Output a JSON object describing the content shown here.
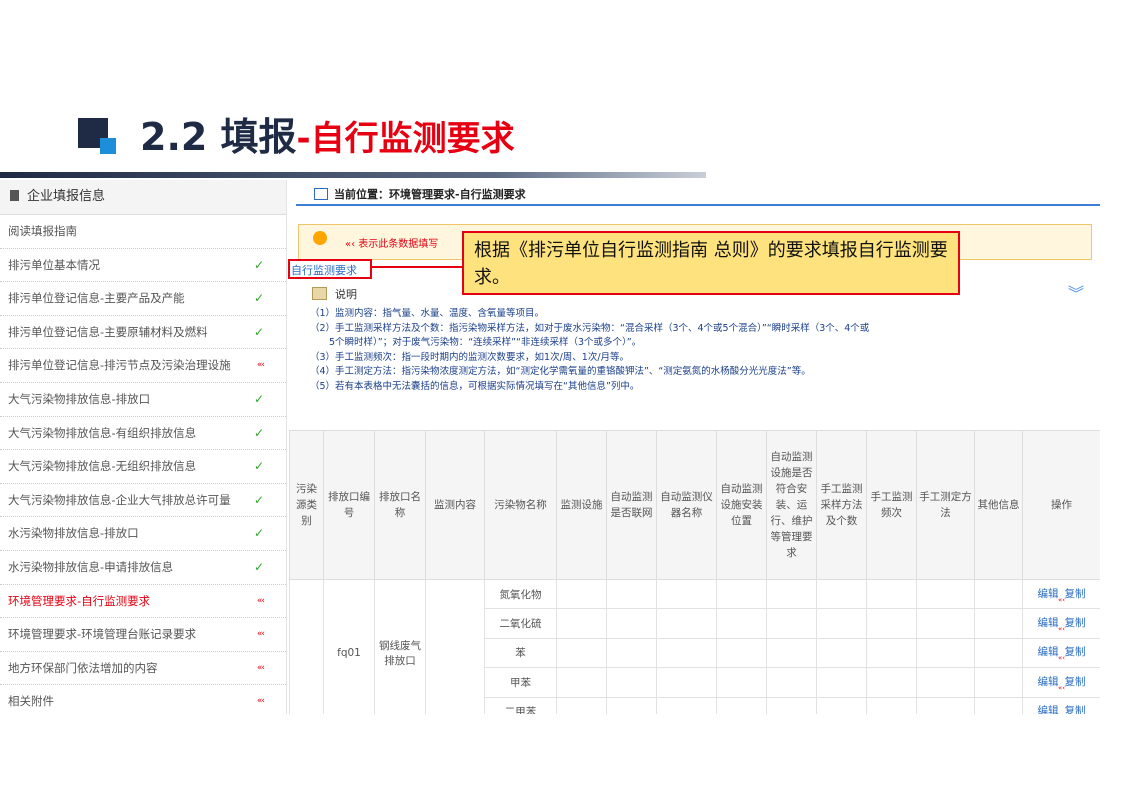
{
  "slide": {
    "title_prefix": "2.2  填报",
    "title_suffix": "-自行监测要求"
  },
  "sidebar": {
    "header": "企业填报信息",
    "items": [
      {
        "label": "阅读填报指南",
        "status": "",
        "active": false
      },
      {
        "label": "排污单位基本情况",
        "status": "✓",
        "active": false
      },
      {
        "label": "排污单位登记信息-主要产品及产能",
        "status": "✓",
        "active": false
      },
      {
        "label": "排污单位登记信息-主要原辅材料及燃料",
        "status": "✓",
        "active": false
      },
      {
        "label": "排污单位登记信息-排污节点及污染治理设施",
        "status": "«‹",
        "active": false
      },
      {
        "label": "大气污染物排放信息-排放口",
        "status": "✓",
        "active": false
      },
      {
        "label": "大气污染物排放信息-有组织排放信息",
        "status": "✓",
        "active": false
      },
      {
        "label": "大气污染物排放信息-无组织排放信息",
        "status": "✓",
        "active": false
      },
      {
        "label": "大气污染物排放信息-企业大气排放总许可量",
        "status": "✓",
        "active": false
      },
      {
        "label": "水污染物排放信息-排放口",
        "status": "✓",
        "active": false
      },
      {
        "label": "水污染物排放信息-申请排放信息",
        "status": "✓",
        "active": false
      },
      {
        "label": "环境管理要求-自行监测要求",
        "status": "«‹",
        "active": true
      },
      {
        "label": "环境管理要求-环境管理台账记录要求",
        "status": "«‹",
        "active": false
      },
      {
        "label": "地方环保部门依法增加的内容",
        "status": "«‹",
        "active": false
      },
      {
        "label": "相关附件",
        "status": "«‹",
        "active": false
      }
    ]
  },
  "main": {
    "breadcrumb": "当前位置：环境管理要求-自行监测要求",
    "notice": "«‹ 表示此条数据填写",
    "callout": "根据《排污单位自行监测指南  总则》的要求填报自行监测要求。",
    "section_link": "自行监测要求",
    "explain_label": "说明",
    "notes": [
      "（1）监测内容：指气量、水量、温度、含氧量等项目。",
      "（2）手工监测采样方法及个数：指污染物采样方法，如对于废水污染物：“混合采样（3个、4个或5个混合）”“瞬时采样（3个、4个或",
      "5个瞬时样）”；对于废气污染物：“连续采样”“非连续采样（3个或多个）”。",
      "（3）手工监测频次：指一段时期内的监测次数要求，如1次/周、1次/月等。",
      "（4）手工测定方法：指污染物浓度测定方法，如“测定化学需氧量的重铬酸钾法”、“测定氨氮的水杨酸分光光度法”等。",
      "（5）若有本表格中无法囊括的信息，可根据实际情况填写在“其他信息”列中。"
    ]
  },
  "table": {
    "headers": [
      "污染源类别",
      "排放口编号",
      "排放口名称",
      "监测内容",
      "污染物名称",
      "监测设施",
      "自动监测是否联网",
      "自动监测仪器名称",
      "自动监测设施安装位置",
      "自动监测设施是否符合安装、运行、维护等管理要求",
      "手工监测采样方法及个数",
      "手工监测频次",
      "手工测定方法",
      "其他信息",
      "操作"
    ],
    "outlet_code": "fq01",
    "outlet_name": "钢线废气排放口",
    "pollutants": [
      "氮氧化物",
      "二氧化硫",
      "苯",
      "甲苯",
      "二甲苯"
    ],
    "edit_label": "编辑",
    "copy_label": "复制"
  }
}
